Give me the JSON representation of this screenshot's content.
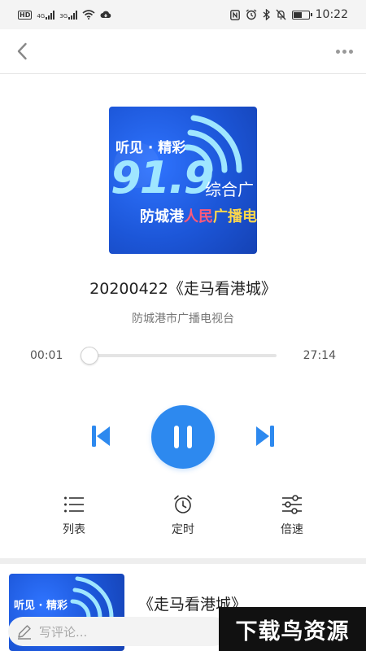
{
  "status_bar": {
    "hd_label": "HD",
    "net_4g": "4G",
    "net_3g": "3G",
    "time": "10:22",
    "battery_percent": 55
  },
  "cover": {
    "slogan": "听见 · 精彩",
    "frequency": "91.9",
    "channel_type": "综合广",
    "station_part1": "防城港",
    "station_part2": "人民",
    "station_part3": "广播电"
  },
  "player": {
    "title": "20200422《走马看港城》",
    "station": "防城港市广播电视台",
    "current_time": "00:01",
    "total_time": "27:14",
    "progress": 0.0
  },
  "tools": {
    "list_label": "列表",
    "timer_label": "定时",
    "speed_label": "倍速"
  },
  "related": {
    "title": "《走马看港城》"
  },
  "comment": {
    "placeholder": "写评论..."
  },
  "watermark": {
    "text": "下载鸟资源"
  },
  "colors": {
    "accent": "#2d89ef",
    "cover_blue": "#1c56d8"
  }
}
